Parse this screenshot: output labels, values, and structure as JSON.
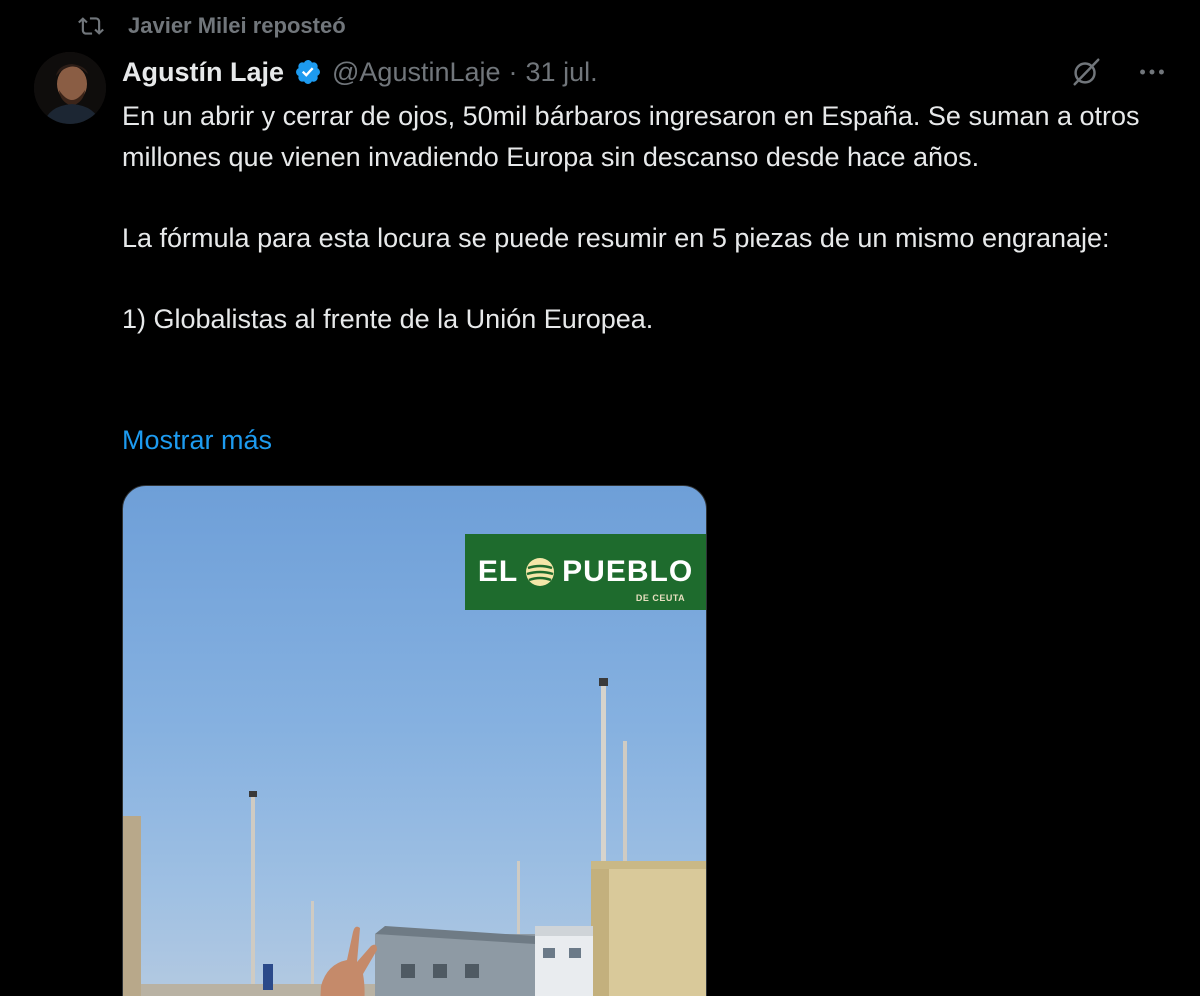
{
  "repost": {
    "label": "Javier Milei reposteó",
    "icon": "repost-icon"
  },
  "author": {
    "name": "Agustín Laje",
    "handle": "@AgustinLaje",
    "separator": "·",
    "date": "31 jul.",
    "verified_icon": "verified-badge-icon",
    "avatar_icon": "avatar"
  },
  "actions": {
    "grok_icon": "grok-icon",
    "more_icon": "more-options-icon"
  },
  "tweet": {
    "paragraphs": [
      "En un abrir y cerrar de ojos, 50mil bárbaros ingresaron en España. Se suman a otros millones que vienen invadiendo Europa sin descanso desde hace años.",
      "La fórmula para esta locura se puede resumir en 5 piezas de un mismo engranaje:",
      "1) Globalistas al frente de la Unión Europea."
    ],
    "show_more": "Mostrar más"
  },
  "media": {
    "logo_left": "EL",
    "logo_right": "PUEBLO",
    "logo_sub": "DE CEUTA"
  },
  "colors": {
    "background": "#000000",
    "text": "#e7e9ea",
    "muted": "#71767b",
    "link": "#1d9bf0",
    "verified": "#1d9bf0",
    "logo_green": "#1e6b2d"
  }
}
